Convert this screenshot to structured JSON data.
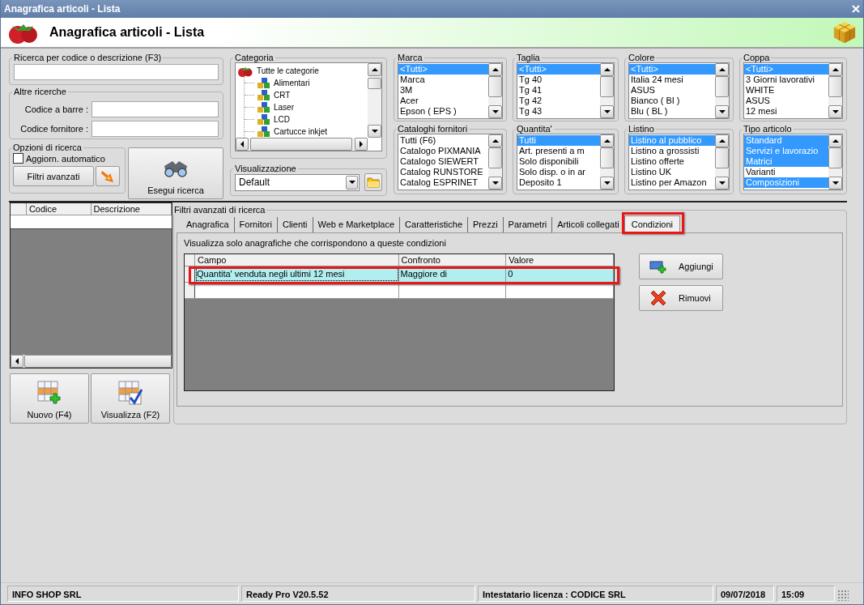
{
  "window": {
    "title": "Anagrafica articoli  - Lista"
  },
  "header": {
    "title": "Anagrafica articoli  - Lista"
  },
  "search": {
    "label": "Ricerca per codice o descrizione (F3)"
  },
  "other_searches": {
    "label": "Altre ricerche",
    "fields": [
      {
        "label": "Codice a barre :"
      },
      {
        "label": "Codice fornitore :"
      }
    ]
  },
  "search_options": {
    "label": "Opzioni di ricerca",
    "auto_update": {
      "label": "Aggiorn. automatico",
      "checked": false
    },
    "advanced_button": "Filtri avanzati"
  },
  "run_search_button": "Esegui ricerca",
  "category": {
    "label": "Categoria",
    "tree": [
      {
        "label": "Tutte le categorie",
        "children": [
          {
            "label": "Alimentari"
          },
          {
            "label": "CRT"
          },
          {
            "label": "Laser"
          },
          {
            "label": "LCD"
          },
          {
            "label": "Cartucce inkjet"
          }
        ]
      }
    ]
  },
  "view": {
    "label": "Visualizzazione",
    "value": "Default"
  },
  "filters": [
    {
      "label": "Marca",
      "items": [
        {
          "text": "<Tutti>",
          "selected": true
        },
        {
          "text": "Marca",
          "selected": false
        },
        {
          "text": "3M",
          "selected": false
        },
        {
          "text": "Acer",
          "selected": false
        },
        {
          "text": "Epson ( EPS )",
          "selected": false
        }
      ]
    },
    {
      "label": "Taglia",
      "items": [
        {
          "text": "<Tutti>",
          "selected": true
        },
        {
          "text": "Tg 40",
          "selected": false
        },
        {
          "text": "Tg 41",
          "selected": false
        },
        {
          "text": "Tg 42",
          "selected": false
        },
        {
          "text": "Tg 43",
          "selected": false
        }
      ]
    },
    {
      "label": "Colore",
      "items": [
        {
          "text": "<Tutti>",
          "selected": true
        },
        {
          "text": "Italia 24 mesi",
          "selected": false
        },
        {
          "text": "ASUS",
          "selected": false
        },
        {
          "text": "Bianco ( BI )",
          "selected": false
        },
        {
          "text": "Blu ( BL )",
          "selected": false
        }
      ]
    },
    {
      "label": "Coppa",
      "items": [
        {
          "text": "<Tutti>",
          "selected": true
        },
        {
          "text": "3 Giorni lavorativi",
          "selected": false
        },
        {
          "text": "WHITE",
          "selected": false
        },
        {
          "text": "ASUS",
          "selected": false
        },
        {
          "text": "12 mesi",
          "selected": false
        }
      ]
    },
    {
      "label": "Cataloghi fornitori",
      "items": [
        {
          "text": "Tutti (F6)",
          "selected": false
        },
        {
          "text": "Catalogo PIXMANIA",
          "selected": false
        },
        {
          "text": "Catalogo SIEWERT",
          "selected": false
        },
        {
          "text": "Catalog RUNSTORE",
          "selected": false
        },
        {
          "text": "Catalog ESPRINET",
          "selected": false
        }
      ]
    },
    {
      "label": "Quantita'",
      "items": [
        {
          "text": "Tutti",
          "selected": true
        },
        {
          "text": "Art. presenti a m",
          "selected": false
        },
        {
          "text": "Solo disponibili",
          "selected": false
        },
        {
          "text": "Solo disp. o in ar",
          "selected": false
        },
        {
          "text": "Deposito 1",
          "selected": false
        }
      ]
    },
    {
      "label": "Listino",
      "items": [
        {
          "text": "Listino al pubblico",
          "selected": true
        },
        {
          "text": "Listino a grossisti",
          "selected": false
        },
        {
          "text": "Listino offerte",
          "selected": false
        },
        {
          "text": "Listino UK",
          "selected": false
        },
        {
          "text": "Listino per Amazon",
          "selected": false
        }
      ]
    },
    {
      "label": "Tipo articolo",
      "items": [
        {
          "text": "Standard",
          "selected": true
        },
        {
          "text": "Servizi e lavorazio",
          "selected": true
        },
        {
          "text": "Matrici",
          "selected": true
        },
        {
          "text": "Varianti",
          "selected": false
        },
        {
          "text": "Composizioni",
          "selected": true
        }
      ]
    }
  ],
  "results_table": {
    "columns": [
      "Codice",
      "Descrizione"
    ]
  },
  "buttons": [
    "Nuovo (F4)",
    "Visualizza (F2)"
  ],
  "advanced": {
    "label": "Filtri avanzati di ricerca",
    "tabs": [
      {
        "label": "Anagrafica",
        "selected": false,
        "highlighted": false
      },
      {
        "label": "Fornitori",
        "selected": false,
        "highlighted": false
      },
      {
        "label": "Clienti",
        "selected": false,
        "highlighted": false
      },
      {
        "label": "Web e Marketplace",
        "selected": false,
        "highlighted": false
      },
      {
        "label": "Caratteristiche",
        "selected": false,
        "highlighted": false
      },
      {
        "label": "Prezzi",
        "selected": false,
        "highlighted": false
      },
      {
        "label": "Parametri",
        "selected": false,
        "highlighted": false
      },
      {
        "label": "Articoli collegati",
        "selected": false,
        "highlighted": false
      },
      {
        "label": "Condizioni",
        "selected": true,
        "highlighted": true
      }
    ],
    "hint": "Visualizza solo anagrafiche che corrispondono a queste condizioni",
    "table": {
      "columns": [
        "Campo",
        "Confronto",
        "Valore"
      ],
      "rows": [
        {
          "cells": [
            "Quantita' venduta negli ultimi 12 mesi",
            "Maggiore di",
            "0"
          ],
          "selected": true,
          "highlighted": true
        }
      ]
    },
    "buttons": [
      "Aggiungi",
      "Rimuovi"
    ]
  },
  "status_bar": [
    "INFO SHOP SRL",
    "Ready Pro V20.5.52",
    "Intestatario licenza : CODICE SRL",
    "09/07/2018",
    "15:09"
  ]
}
